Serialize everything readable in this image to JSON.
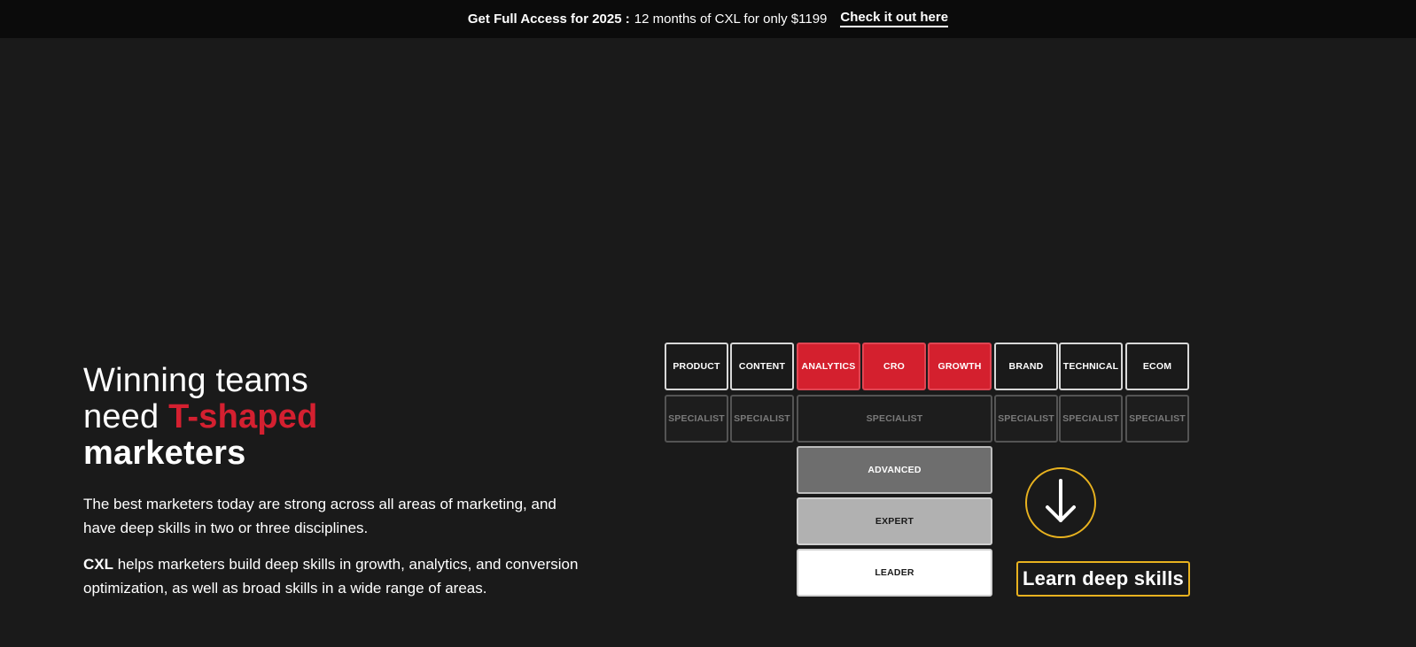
{
  "topbar": {
    "promo_strong": "Get Full Access for 2025 :",
    "promo_rest": "12 months of CXL for only $1199",
    "cta": "Check it out here"
  },
  "hero": {
    "title_line1": "Winning teams",
    "title_line2_prefix": "need ",
    "title_accent": "T-shaped",
    "title_line3": "marketers",
    "paragraph1": "The best marketers today are strong across all areas of marketing, and have deep skills in two or three disciplines.",
    "paragraph2_brand": "CXL",
    "paragraph2_rest": " helps marketers build deep skills in growth, analytics, and conversion optimization, as well as broad skills in a wide range of areas."
  },
  "tshape": {
    "disciplines": [
      {
        "label": "PRODUCT",
        "highlighted": false
      },
      {
        "label": "CONTENT",
        "highlighted": false
      },
      {
        "label": "ANALYTICS",
        "highlighted": true
      },
      {
        "label": "CRO",
        "highlighted": true
      },
      {
        "label": "GROWTH",
        "highlighted": true
      },
      {
        "label": "BRAND",
        "highlighted": false
      },
      {
        "label": "TECHNICAL",
        "highlighted": false
      },
      {
        "label": "ECOM",
        "highlighted": false
      }
    ],
    "specialist_label": "SPECIALIST",
    "levels": [
      "ADVANCED",
      "EXPERT",
      "LEADER"
    ],
    "cta_label": "Learn deep skills",
    "cta_icon": "arrow-down-icon"
  },
  "colors": {
    "background": "#1a1a1a",
    "topbar": "#0b0b0b",
    "accent_red": "#d4202e",
    "accent_gold": "#e8b21f"
  }
}
